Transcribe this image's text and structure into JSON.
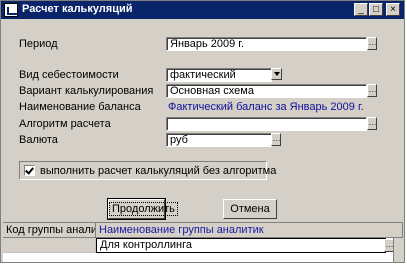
{
  "window": {
    "title": "Расчет калькуляций",
    "controls": {
      "minimize": "_",
      "maximize": "□",
      "close": "×"
    }
  },
  "form": {
    "period": {
      "label": "Период",
      "value": "Январь 2009 г."
    },
    "cost_type": {
      "label": "Вид себестоимости",
      "value": "фактический"
    },
    "variant": {
      "label": "Вариант калькулирования",
      "value": "Основная схема"
    },
    "balance": {
      "label": "Наименование баланса",
      "value": "Фактический баланс за Январь 2009 г."
    },
    "algorithm": {
      "label": "Алгоритм расчета",
      "value": ""
    },
    "currency": {
      "label": "Валюта",
      "value": "руб"
    },
    "no_algorithm_checkbox": {
      "label": "выполнить расчет калькуляций без алгоритма",
      "checked": true
    }
  },
  "buttons": {
    "continue": "Продолжить",
    "cancel": "Отмена"
  },
  "grid": {
    "columns": [
      "Код группы аналитик",
      "Наименование группы аналитик"
    ],
    "rows": [
      {
        "code": "",
        "name": "Для контроллинга"
      }
    ]
  },
  "icons": {
    "dots": "…",
    "dropdown": "chevron-down-icon",
    "window_icon": "calc-app-icon"
  },
  "colors": {
    "titlebar": "#0a246a",
    "face": "#d4d0c8",
    "balance_text": "#10109a",
    "grid_header_name": "#1a1aa0"
  }
}
